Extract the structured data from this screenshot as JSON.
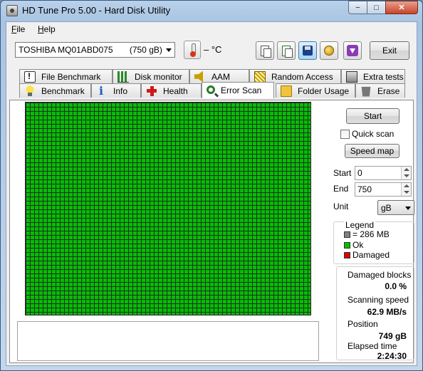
{
  "window": {
    "title": "HD Tune Pro 5.00 - Hard Disk Utility",
    "minimize_glyph": "−",
    "maximize_glyph": "□",
    "close_glyph": "✕"
  },
  "menu": {
    "file_letter": "F",
    "file_rest": "ile",
    "help_letter": "H",
    "help_rest": "elp"
  },
  "toolbar": {
    "drive": "TOSHIBA MQ01ABD075       (750 gB)",
    "temperature": "– °C",
    "exit_label": "Exit",
    "icons": [
      "copy-text-icon",
      "copy-screenshot-icon",
      "save-icon",
      "options-icon",
      "download-icon"
    ]
  },
  "tabs": {
    "row_back": [
      "File Benchmark",
      "Disk monitor",
      "AAM",
      "Random Access",
      "Extra tests"
    ],
    "row_front": [
      "Benchmark",
      "Info",
      "Health",
      "Error Scan",
      "Folder Usage",
      "Erase"
    ],
    "selected": "Error Scan"
  },
  "scan": {
    "start_button": "Start",
    "quick_scan_label": "Quick scan",
    "quick_scan_checked": false,
    "speed_map_button": "Speed map",
    "start_label": "Start",
    "start_value": "0",
    "end_label": "End",
    "end_value": "750",
    "unit_label": "Unit",
    "unit_value": "gB",
    "grid_status": "ok",
    "colors": {
      "ok": "#00c000",
      "damaged": "#e00000",
      "block": "#808080"
    }
  },
  "legend": {
    "title": "Legend",
    "block_size": "= 286 MB",
    "ok": "Ok",
    "damaged": "Damaged"
  },
  "stats": {
    "damaged_blocks_label": "Damaged blocks",
    "damaged_blocks_value": "0.0 %",
    "scanning_speed_label": "Scanning speed",
    "scanning_speed_value": "62.9 MB/s",
    "position_label": "Position",
    "position_value": "749 gB",
    "elapsed_time_label": "Elapsed time",
    "elapsed_time_value": "2:24:30"
  }
}
